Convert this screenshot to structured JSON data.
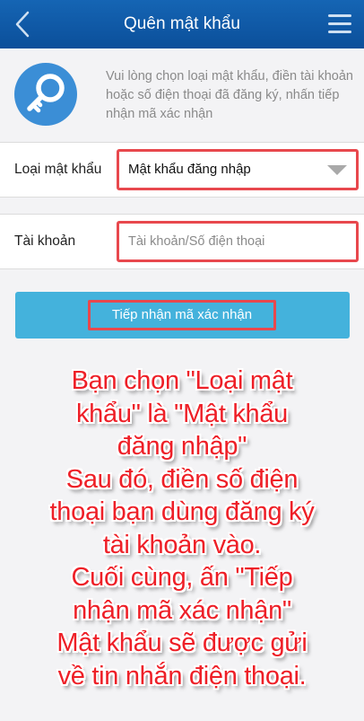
{
  "header": {
    "title": "Quên mật khẩu",
    "back_icon": "chevron-left-icon",
    "menu_icon": "hamburger-menu-icon",
    "background_color": "#0f5aa8"
  },
  "intro": {
    "icon": "key-icon",
    "text": "Vui lòng chọn loại mật khẩu, điền tài khoản hoặc số điện thoại đã đăng ký, nhấn tiếp nhận mã xác nhận"
  },
  "form": {
    "password_type": {
      "label": "Loại mật khẩu",
      "selected_value": "Mật khẩu đăng nhập"
    },
    "account": {
      "label": "Tài khoản",
      "value": "",
      "placeholder": "Tài khoản/Số điện thoại"
    },
    "submit_label": "Tiếp nhận mã xác nhận"
  },
  "instructions": [
    "Bạn chọn \"Loại mật",
    "khẩu\" là \"Mật khẩu",
    "đăng nhập\"",
    "Sau đó, điền số điện",
    "thoại bạn dùng đăng ký",
    "tài khoản vào.",
    "Cuối cùng, ấn \"Tiếp",
    "nhận mã xác nhận\"",
    "Mật khẩu sẽ được gửi",
    "về tin nhắn điện thoại."
  ],
  "colors": {
    "accent": "#44b2dc",
    "highlight_border": "#e8484d",
    "annotation_text": "#ee1f27"
  }
}
